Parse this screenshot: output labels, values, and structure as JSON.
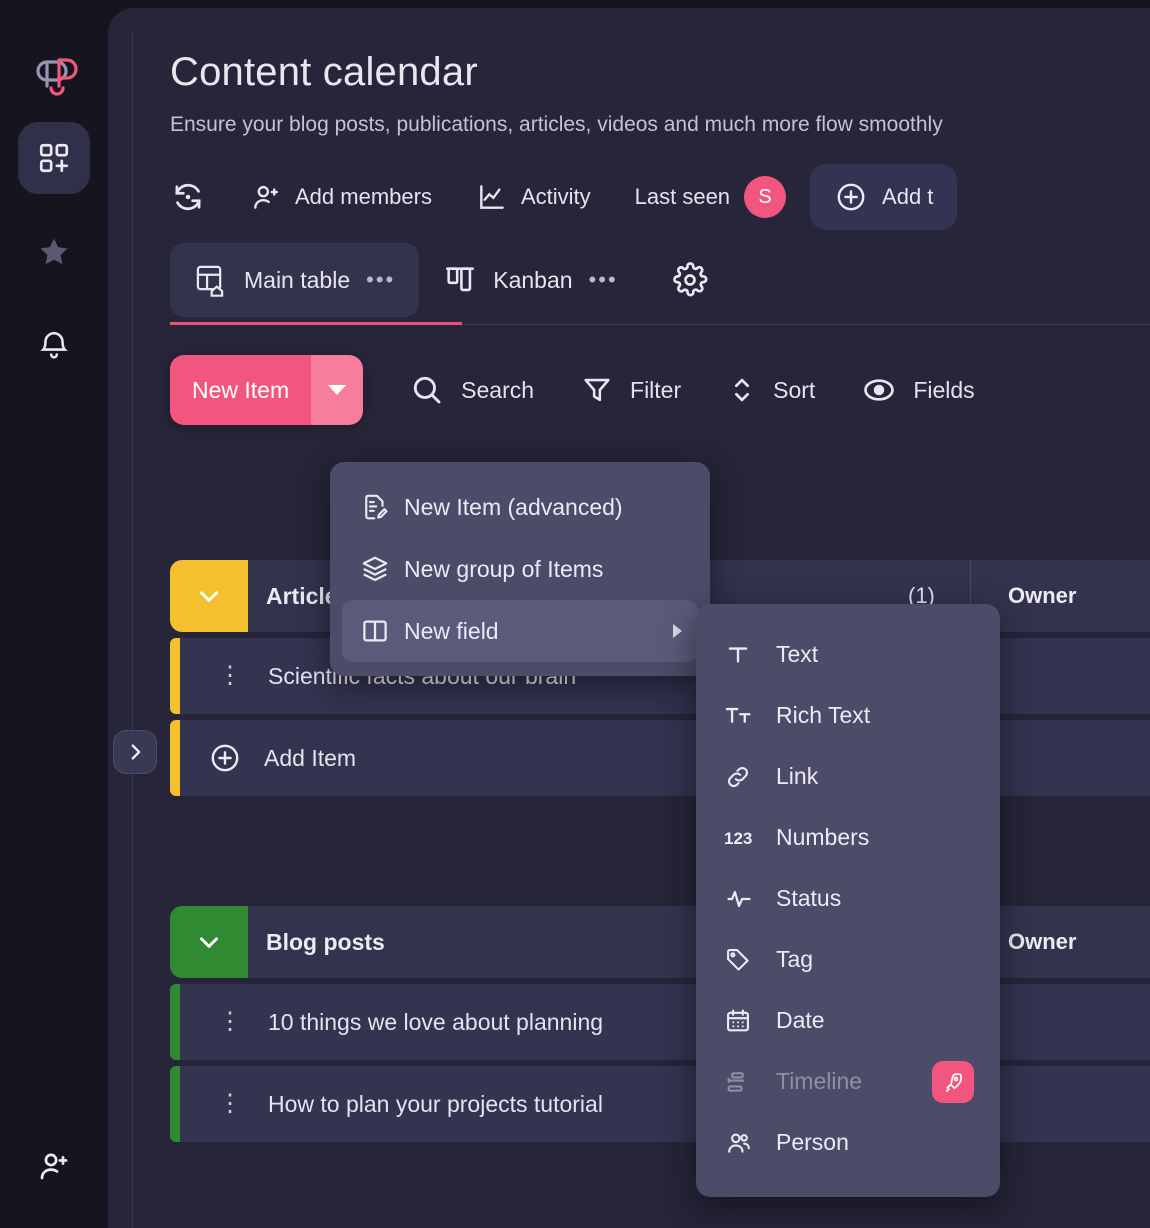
{
  "sidebar": {
    "logo": "logo-mark",
    "items": [
      {
        "name": "boards",
        "icon": "grid-plus-icon",
        "active": true
      },
      {
        "name": "favorites",
        "icon": "star-icon",
        "active": false
      },
      {
        "name": "notifications",
        "icon": "bell-icon",
        "active": false
      }
    ],
    "bottom": {
      "name": "invite",
      "icon": "add-person-icon"
    }
  },
  "header": {
    "title": "Content calendar",
    "subtitle": "Ensure your blog posts, publications, articles, videos and much more flow smoothly"
  },
  "toolbar": {
    "refresh_icon": "refresh-history-icon",
    "add_members": "Add members",
    "activity": "Activity",
    "last_seen": "Last seen",
    "avatar_initial": "S",
    "add_to": "Add t"
  },
  "tabs": [
    {
      "label": "Main table",
      "icon": "table-home-icon",
      "dots": "•••",
      "active": true
    },
    {
      "label": "Kanban",
      "icon": "kanban-icon",
      "dots": "•••",
      "active": false
    }
  ],
  "tabs_settings_icon": "gear-icon",
  "actionbar": {
    "new_item": "New Item",
    "search": "Search",
    "filter": "Filter",
    "sort": "Sort",
    "fields": "Fields"
  },
  "dropdown": {
    "items": [
      {
        "label": "New Item (advanced)",
        "icon": "document-edit-icon",
        "highlight": false,
        "has_submenu": false
      },
      {
        "label": "New group of Items",
        "icon": "layers-icon",
        "highlight": false,
        "has_submenu": false
      },
      {
        "label": "New field",
        "icon": "columns-icon",
        "highlight": true,
        "has_submenu": true
      }
    ]
  },
  "field_submenu": {
    "items": [
      {
        "label": "Text",
        "icon": "text-icon",
        "disabled": false,
        "badge": null
      },
      {
        "label": "Rich Text",
        "icon": "rich-text-icon",
        "disabled": false,
        "badge": null
      },
      {
        "label": "Link",
        "icon": "link-icon",
        "disabled": false,
        "badge": null
      },
      {
        "label": "Numbers",
        "icon": "numbers-icon",
        "disabled": false,
        "badge": null
      },
      {
        "label": "Status",
        "icon": "status-pulse-icon",
        "disabled": false,
        "badge": null
      },
      {
        "label": "Tag",
        "icon": "tag-icon",
        "disabled": false,
        "badge": null
      },
      {
        "label": "Date",
        "icon": "calendar-icon",
        "disabled": false,
        "badge": null
      },
      {
        "label": "Timeline",
        "icon": "timeline-icon",
        "disabled": true,
        "badge": "rocket-icon"
      },
      {
        "label": "Person",
        "icon": "person-icon",
        "disabled": false,
        "badge": null
      }
    ]
  },
  "table": {
    "groups": [
      {
        "name": "Articles",
        "color": "#f5c02e",
        "count": "(1)",
        "owner_header": "Owner",
        "items": [
          {
            "title": "Scientific facts about our brain",
            "owner": ""
          }
        ],
        "add_item_label": "Add Item"
      },
      {
        "name": "Blog posts",
        "color": "#2f8a32",
        "count": "",
        "owner_header": "Owner",
        "items": [
          {
            "title": "10 things we love about planning",
            "owner": ""
          },
          {
            "title": "How to plan your projects tutorial",
            "owner": ""
          }
        ],
        "add_item_label": ""
      }
    ]
  },
  "collapse_button": {
    "icon": "chevron-right-icon"
  },
  "colors": {
    "accent_pink": "#f2567f",
    "panel_bg": "#262539",
    "rail_bg": "#16151f",
    "menu_bg": "#4c4b68",
    "row_bg": "#343350",
    "group_yellow": "#f5c02e",
    "group_green": "#2f8a32"
  }
}
